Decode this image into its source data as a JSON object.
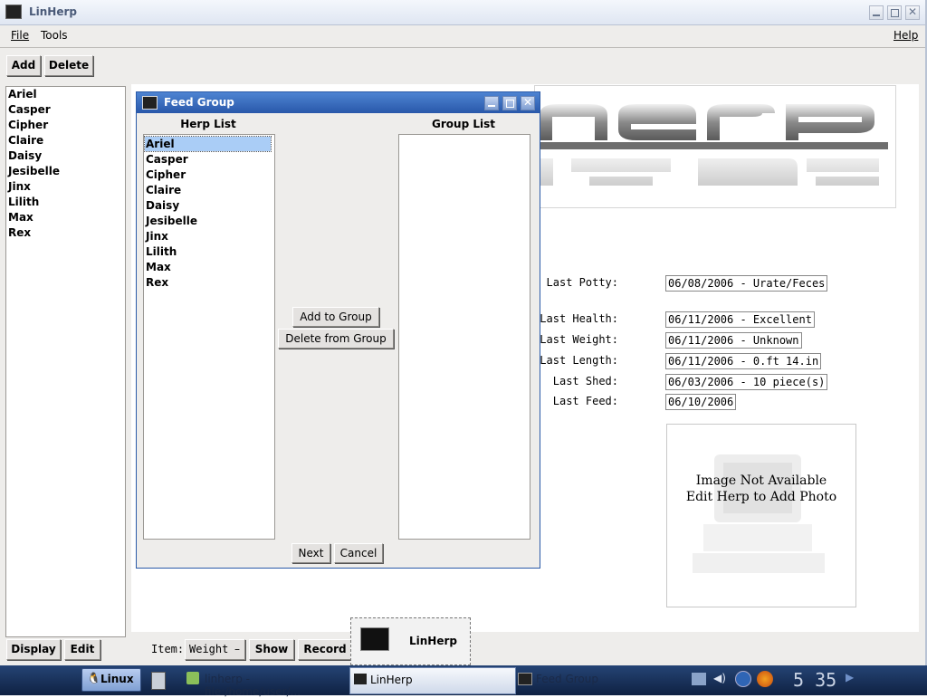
{
  "window": {
    "title": "LinHerp"
  },
  "menu": {
    "file": "File",
    "tools": "Tools",
    "help": "Help"
  },
  "toolbar": {
    "add": "Add",
    "delete": "Delete"
  },
  "herps": [
    "Ariel",
    "Casper",
    "Cipher",
    "Claire",
    "Daisy",
    "Jesibelle",
    "Jinx",
    "Lilith",
    "Max",
    "Rex"
  ],
  "details": {
    "labels": [
      "Last Potty:",
      "Last Health:",
      "Last Weight:",
      "Last Length:",
      "Last Shed:",
      "Last Feed:"
    ],
    "values": [
      "06/08/2006 - Urate/Feces",
      "06/11/2006 - Excellent",
      "06/11/2006 - Unknown",
      "06/11/2006 - 0.ft 14.in",
      "06/03/2006 - 10 piece(s)",
      "06/10/2006"
    ]
  },
  "photo": {
    "line1": "Image Not Available",
    "line2": "Edit Herp to Add Photo"
  },
  "bottom": {
    "display": "Display",
    "edit": "Edit",
    "item_label": "Item:",
    "item_value": "Weight",
    "show": "Show",
    "record": "Record"
  },
  "dialog": {
    "title": "Feed Group",
    "herp_list_header": "Herp List",
    "group_list_header": "Group List",
    "add_to_group": "Add to Group",
    "delete_from_group": "Delete from Group",
    "next": "Next",
    "cancel": "Cancel",
    "selected": "Ariel"
  },
  "tooltip": {
    "label": "LinHerp"
  },
  "taskbar": {
    "start": "Linux",
    "tasks": [
      "linherp - file:/home/user/...",
      "LinHerp",
      "Feed Group"
    ],
    "clock": "5 35"
  },
  "colors": {
    "titlebar": "#eaf0fa",
    "dialog_title": "#2d62b8",
    "taskbar": "#152a4f",
    "selected": "#aacdf6"
  }
}
